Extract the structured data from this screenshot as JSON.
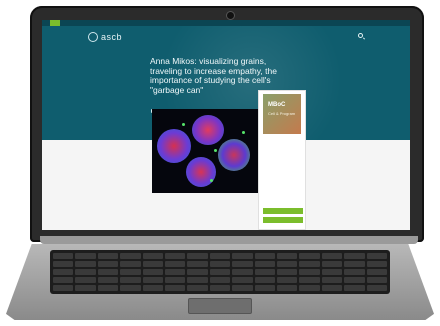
{
  "site": {
    "logo_text": "ascb",
    "member_button": "",
    "top_links": [
      "",
      "",
      ""
    ],
    "nav": [
      "",
      "",
      "",
      "",
      ""
    ]
  },
  "article": {
    "breadcrumb": "",
    "headline": "Anna Mikos: visualizing grains, traveling to increase empathy, the importance of studying the cell's \"garbage can\"",
    "byline": "",
    "caption": "",
    "body": ""
  },
  "sidebar": {
    "ad_title": "MBoC",
    "ad_subtitle": "Cell & Program",
    "heading": "",
    "links": [
      "",
      "",
      "",
      ""
    ],
    "button1": "",
    "button2": ""
  },
  "colors": {
    "hero": "#0f5d6e",
    "accent_green": "#7bbd2c"
  }
}
